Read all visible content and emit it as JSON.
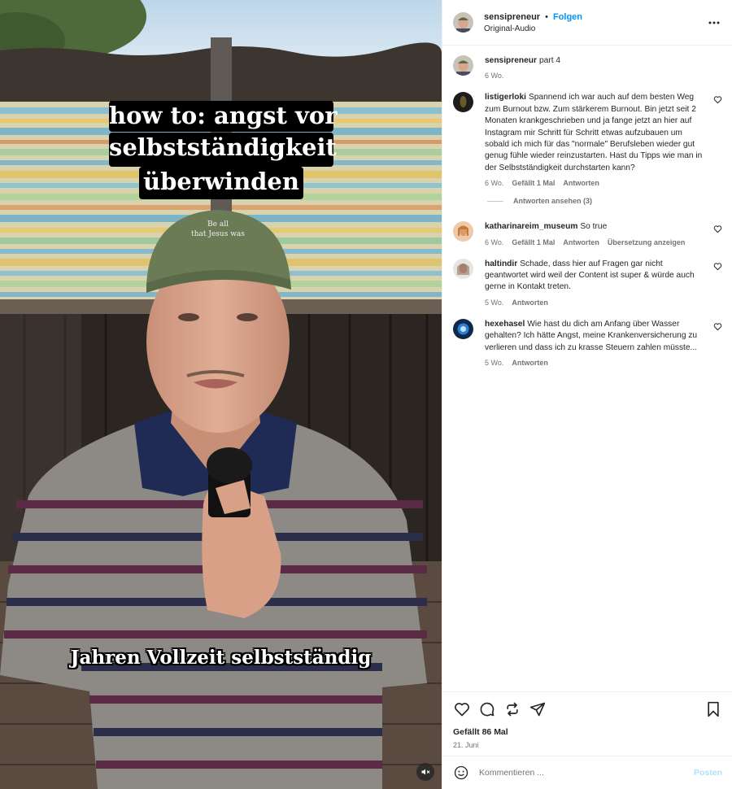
{
  "video": {
    "caption_lines": [
      "how to: angst vor",
      "selbstständigkeit",
      "überwinden"
    ],
    "cap_text": "Be all\nthat Jesus was",
    "subtitle": "Jahren Vollzeit selbstständig"
  },
  "header": {
    "username": "sensipreneur",
    "separator": "•",
    "follow_label": "Folgen",
    "audio": "Original-Audio"
  },
  "comments": [
    {
      "username": "sensipreneur",
      "text": "part 4",
      "time": "6 Wo.",
      "likes": "",
      "reply": "",
      "translate": "",
      "like_button": false
    },
    {
      "username": "listigerloki",
      "text": "Spannend ich war auch auf dem besten Weg zum Burnout bzw. Zum stärkerem Burnout. Bin jetzt seit 2 Monaten krankgeschrieben und ja fange jetzt an hier auf Instagram mir Schritt für Schritt etwas aufzubauen um sobald ich mich für das \"normale\" Berufsleben wieder gut genug fühle wieder reinzustarten. Hast du Tipps wie man in der Selbstständigkeit durchstarten kann?",
      "time": "6 Wo.",
      "likes": "Gefällt 1 Mal",
      "reply": "Antworten",
      "translate": "",
      "like_button": true,
      "view_replies": "Antworten ansehen (3)"
    },
    {
      "username": "katharinareim_museum",
      "text": "So true",
      "time": "6 Wo.",
      "likes": "Gefällt 1 Mal",
      "reply": "Antworten",
      "translate": "Übersetzung anzeigen",
      "like_button": true
    },
    {
      "username": "haltindir",
      "text": "Schade, dass hier auf Fragen gar nicht geantwortet wird weil der Content ist super & würde auch gerne in Kontakt treten.",
      "time": "5 Wo.",
      "likes": "",
      "reply": "Antworten",
      "translate": "",
      "like_button": true
    },
    {
      "username": "hexehasel",
      "text": "Wie hast du dich am Anfang über Wasser gehalten? Ich hätte Angst, meine Krankenversicherung zu verlieren und dass ich zu krasse Steuern zahlen müsste...",
      "time": "5 Wo.",
      "likes": "",
      "reply": "Antworten",
      "translate": "",
      "like_button": true
    }
  ],
  "footer": {
    "likes": "Gefällt 86 Mal",
    "date": "21. Juni",
    "comment_placeholder": "Kommentieren ...",
    "post_label": "Posten"
  },
  "icons": {
    "more": "more-options-icon",
    "like": "heart-icon",
    "comment": "comment-icon",
    "share": "repost-icon",
    "send": "send-icon",
    "save": "bookmark-icon",
    "emoji": "emoji-icon",
    "mute": "muted-speaker-icon"
  },
  "colors": {
    "link": "#0095f6",
    "muted_text": "#737373",
    "post_disabled": "#b2dffc"
  }
}
